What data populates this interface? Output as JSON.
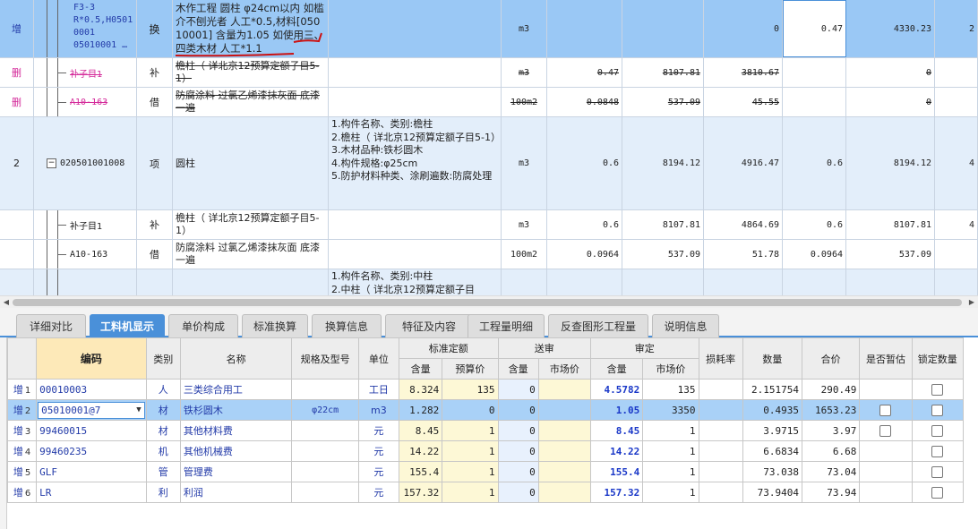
{
  "upper_rows": [
    {
      "mark": "增",
      "code": [
        "F3-3",
        "R*0.5,H0501",
        "0001",
        "05010001 …"
      ],
      "type": "换",
      "name": "木作工程 圆柱 φ24cm以内 如槛介不刨光者 人工*0.5,材料[05010001] 含量为1.05 如使用三、四类木材 人工*1.1",
      "unit": "m3",
      "qty": "",
      "price": "",
      "total": "0",
      "qty2": "0.47",
      "price2": "4330.23",
      "extra": "2"
    },
    {
      "mark": "删",
      "code": [
        "补子目1"
      ],
      "type": "补",
      "name": "檐柱（ 详北京12预算定额子目5-1）",
      "unit": "m3",
      "qty": "0.47",
      "price": "8107.81",
      "total": "3810.67",
      "qty2": "",
      "price2": "0",
      "extra": ""
    },
    {
      "mark": "删",
      "code": [
        "A10-163"
      ],
      "type": "借",
      "name": "防腐涂料 过氯乙烯漆抹灰面 底漆一遍",
      "unit": "100m2",
      "qty": "0.0848",
      "price": "537.09",
      "total": "45.55",
      "qty2": "",
      "price2": "0",
      "extra": ""
    },
    {
      "mark": "2",
      "code": [
        "020501001008"
      ],
      "type": "项",
      "name": "圆柱",
      "feature": [
        "1.构件名称、类别:檐柱",
        "2.檐柱（ 详北京12预算定额子目5-1）",
        "3.木材品种:铁杉圆木",
        "4.构件规格:φ25cm",
        "5.防护材料种类、涂刷遍数:防腐处理"
      ],
      "unit": "m3",
      "qty": "0.6",
      "price": "8194.12",
      "total": "4916.47",
      "qty2": "0.6",
      "price2": "8194.12",
      "extra": "4"
    },
    {
      "mark": "",
      "code": [
        "补子目1"
      ],
      "type": "补",
      "name": "檐柱（ 详北京12预算定额子目5-1）",
      "unit": "m3",
      "qty": "0.6",
      "price": "8107.81",
      "total": "4864.69",
      "qty2": "0.6",
      "price2": "8107.81",
      "extra": "4"
    },
    {
      "mark": "",
      "code": [
        "A10-163"
      ],
      "type": "借",
      "name": "防腐涂料 过氯乙烯漆抹灰面 底漆一遍",
      "unit": "100m2",
      "qty": "0.0964",
      "price": "537.09",
      "total": "51.78",
      "qty2": "0.0964",
      "price2": "537.09",
      "extra": ""
    },
    {
      "mark": "",
      "code": [
        ""
      ],
      "type": "",
      "name": "",
      "feature": [
        "1.构件名称、类别:中柱",
        "2.中柱（ 详北京12预算定额子目"
      ],
      "unit": "",
      "qty": "",
      "price": "",
      "total": "",
      "qty2": "",
      "price2": "",
      "extra": ""
    }
  ],
  "tabs": [
    "详细对比",
    "工料机显示",
    "单价构成",
    "标准换算",
    "换算信息",
    "特征及内容",
    "工程量明细",
    "反查图形工程量",
    "说明信息"
  ],
  "active_tab": "工料机显示",
  "grid": {
    "headers": {
      "code": "编码",
      "category": "类别",
      "name": "名称",
      "spec": "规格及型号",
      "unit": "单位",
      "std_group": "标准定额",
      "send_group": "送审",
      "audit_group": "审定",
      "loss": "损耗率",
      "quantity": "数量",
      "sum": "合价",
      "provisional": "是否暂估",
      "lock": "锁定数量",
      "std_content": "含量",
      "std_price": "预算价",
      "send_content": "含量",
      "send_price": "市场价",
      "audit_content": "含量",
      "audit_price": "市场价"
    },
    "rows": [
      {
        "mark": "增",
        "no": "1",
        "code": "00010003",
        "category": "人",
        "name": "三类综合用工",
        "spec": "",
        "unit": "工日",
        "std_content": "8.324",
        "std_price": "135",
        "send_content": "0",
        "send_price": "",
        "audit_content": "4.5782",
        "audit_price": "135",
        "loss": "",
        "quantity": "2.151754",
        "sum": "290.49",
        "provisional": false,
        "lock": true
      },
      {
        "mark": "增",
        "no": "2",
        "code": "05010001@7",
        "category": "材",
        "name": "铁杉圆木",
        "spec": "φ22cm",
        "unit": "m3",
        "std_content": "1.282",
        "std_price": "0",
        "send_content": "0",
        "send_price": "",
        "audit_content": "1.05",
        "audit_price": "3350",
        "loss": "",
        "quantity": "0.4935",
        "sum": "1653.23",
        "provisional": true,
        "lock": true
      },
      {
        "mark": "增",
        "no": "3",
        "code": "99460015",
        "category": "材",
        "name": "其他材料费",
        "spec": "",
        "unit": "元",
        "std_content": "8.45",
        "std_price": "1",
        "send_content": "0",
        "send_price": "",
        "audit_content": "8.45",
        "audit_price": "1",
        "loss": "",
        "quantity": "3.9715",
        "sum": "3.97",
        "provisional": true,
        "lock": true
      },
      {
        "mark": "增",
        "no": "4",
        "code": "99460235",
        "category": "机",
        "name": "其他机械费",
        "spec": "",
        "unit": "元",
        "std_content": "14.22",
        "std_price": "1",
        "send_content": "0",
        "send_price": "",
        "audit_content": "14.22",
        "audit_price": "1",
        "loss": "",
        "quantity": "6.6834",
        "sum": "6.68",
        "provisional": false,
        "lock": true
      },
      {
        "mark": "增",
        "no": "5",
        "code": "GLF",
        "category": "管",
        "name": "管理费",
        "spec": "",
        "unit": "元",
        "std_content": "155.4",
        "std_price": "1",
        "send_content": "0",
        "send_price": "",
        "audit_content": "155.4",
        "audit_price": "1",
        "loss": "",
        "quantity": "73.038",
        "sum": "73.04",
        "provisional": false,
        "lock": true
      },
      {
        "mark": "增",
        "no": "6",
        "code": "LR",
        "category": "利",
        "name": "利润",
        "spec": "",
        "unit": "元",
        "std_content": "157.32",
        "std_price": "1",
        "send_content": "0",
        "send_price": "",
        "audit_content": "157.32",
        "audit_price": "1",
        "loss": "",
        "quantity": "73.9404",
        "sum": "73.94",
        "provisional": false,
        "lock": true
      }
    ]
  },
  "colors": {
    "accent": "#4a90d9",
    "selected_row": "#9ac8f5",
    "deleted_mark": "#d42a9a",
    "annotation": "#cc1111"
  }
}
